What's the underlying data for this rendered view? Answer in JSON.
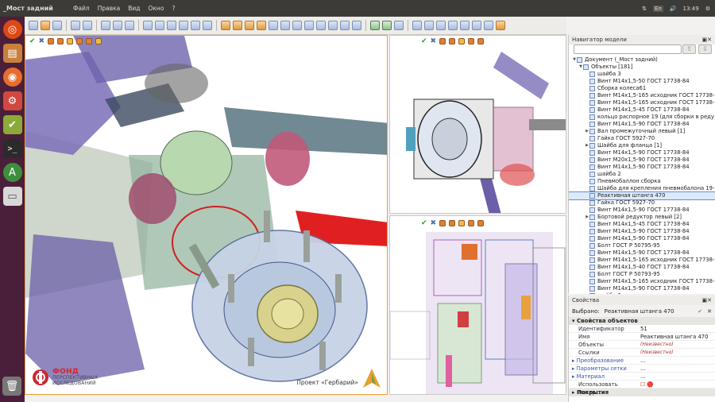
{
  "window": {
    "title": "_Мост задний"
  },
  "menu": [
    "Файл",
    "Правка",
    "Вид",
    "Окно",
    "?"
  ],
  "tray": {
    "lang": "En",
    "clock": "13:49"
  },
  "viewport_main": {
    "project_label": "Проект «Гербарий»",
    "logo_line1": "ФОНД",
    "logo_line2": "ПЕРСПЕКТИВНЫХ",
    "logo_line3": "ИССЛЕДОВАНИЙ"
  },
  "navigator": {
    "title": "Навигатор модели",
    "items": [
      {
        "label": "Документ (_Мост задний)",
        "level": 0,
        "arrow": "▼"
      },
      {
        "label": "Объекты [181]",
        "level": 1,
        "arrow": "▼"
      },
      {
        "label": "шайба 3",
        "level": 2,
        "arrow": ""
      },
      {
        "label": "Винт М14х1,5-50 ГОСТ 17738-84",
        "level": 2,
        "arrow": ""
      },
      {
        "label": "Сборка колеса61",
        "level": 2,
        "arrow": ""
      },
      {
        "label": "Винт М14х1,5-165 исходник ГОСТ 17738-84",
        "level": 2,
        "arrow": ""
      },
      {
        "label": "Винт М14х1,5-165 исходник ГОСТ 17738-84",
        "level": 2,
        "arrow": ""
      },
      {
        "label": "Винт М14х1,5-45 ГОСТ 17738-84",
        "level": 2,
        "arrow": ""
      },
      {
        "label": "кольцо распорное 19 (для сборки в реду…",
        "level": 2,
        "arrow": ""
      },
      {
        "label": "Винт М14х1,5-90 ГОСТ 17738-84",
        "level": 2,
        "arrow": ""
      },
      {
        "label": "Вал промежуточный левый [1]",
        "level": 2,
        "arrow": "▶"
      },
      {
        "label": "Гайка ГОСТ 5927-70",
        "level": 2,
        "arrow": ""
      },
      {
        "label": "Шайба для фланца [1]",
        "level": 2,
        "arrow": "▶"
      },
      {
        "label": "Винт М14х1,5-90 ГОСТ 17738-84",
        "level": 2,
        "arrow": ""
      },
      {
        "label": "Винт М20х1,5-90 ГОСТ 17738-84",
        "level": 2,
        "arrow": ""
      },
      {
        "label": "Винт М14х1,5-90 ГОСТ 17738-84",
        "level": 2,
        "arrow": ""
      },
      {
        "label": "шайба 2",
        "level": 2,
        "arrow": ""
      },
      {
        "label": "Пневмобаллон сборка",
        "level": 2,
        "arrow": ""
      },
      {
        "label": "Шайба для крепления пневмобалона 19-…",
        "level": 2,
        "arrow": ""
      },
      {
        "label": "Реактивная штанга 470",
        "level": 2,
        "arrow": "",
        "selected": true
      },
      {
        "label": "Гайка ГОСТ 5927-70",
        "level": 2,
        "arrow": ""
      },
      {
        "label": "Винт М14х1,5-90 ГОСТ 17738-84",
        "level": 2,
        "arrow": ""
      },
      {
        "label": "Бортовой редуктор левый [2]",
        "level": 2,
        "arrow": "▶"
      },
      {
        "label": "Винт М14х1,5-45 ГОСТ 17738-84",
        "level": 2,
        "arrow": ""
      },
      {
        "label": "Винт М14х1,5-90 ГОСТ 17738-84",
        "level": 2,
        "arrow": ""
      },
      {
        "label": "Винт М14х1,5-90 ГОСТ 17738-84",
        "level": 2,
        "arrow": ""
      },
      {
        "label": "Болт ГОСТ Р 50795-95",
        "level": 2,
        "arrow": ""
      },
      {
        "label": "Винт М14х1,5-90 ГОСТ 17738-84",
        "level": 2,
        "arrow": ""
      },
      {
        "label": "Винт М14х1,5-165 исходник ГОСТ 17738-84",
        "level": 2,
        "arrow": ""
      },
      {
        "label": "Винт М14х1,5-40 ГОСТ 17738-84",
        "level": 2,
        "arrow": ""
      },
      {
        "label": "Болт ГОСТ Р 50793-95",
        "level": 2,
        "arrow": ""
      },
      {
        "label": "Винт М14х1,5-165 исходник ГОСТ 17738-84",
        "level": 2,
        "arrow": ""
      },
      {
        "label": "Винт М14х1,5-90 ГОСТ 17738-84",
        "level": 2,
        "arrow": ""
      },
      {
        "label": "шайба 3",
        "level": 2,
        "arrow": ""
      }
    ]
  },
  "properties": {
    "title": "Свойства",
    "selected_label": "Выбрано:",
    "selected_value": "Реактивная штанга 470",
    "section_objects": "Свойства объектов",
    "rows": [
      {
        "key": "Идентификатор",
        "value": "51",
        "undef": false
      },
      {
        "key": "Имя",
        "value": "Реактивная штанга 470",
        "undef": false
      },
      {
        "key": "Объекты",
        "value": "(Неизвестно)",
        "undef": true
      },
      {
        "key": "Ссылки",
        "value": "(Неизвестно)",
        "undef": true
      }
    ],
    "links": [
      {
        "key": "Преобразование",
        "value": "..."
      },
      {
        "key": "Параметры сетки",
        "value": "..."
      },
      {
        "key": "Материал",
        "value": "..."
      }
    ],
    "use_material": "Использовать матер…",
    "section_cover": "Покрытия"
  },
  "colors": {
    "accent": "#f0a030",
    "launcher": "#4a1f3a",
    "topbar": "#3c3b37",
    "selection": "#dde9f8"
  }
}
